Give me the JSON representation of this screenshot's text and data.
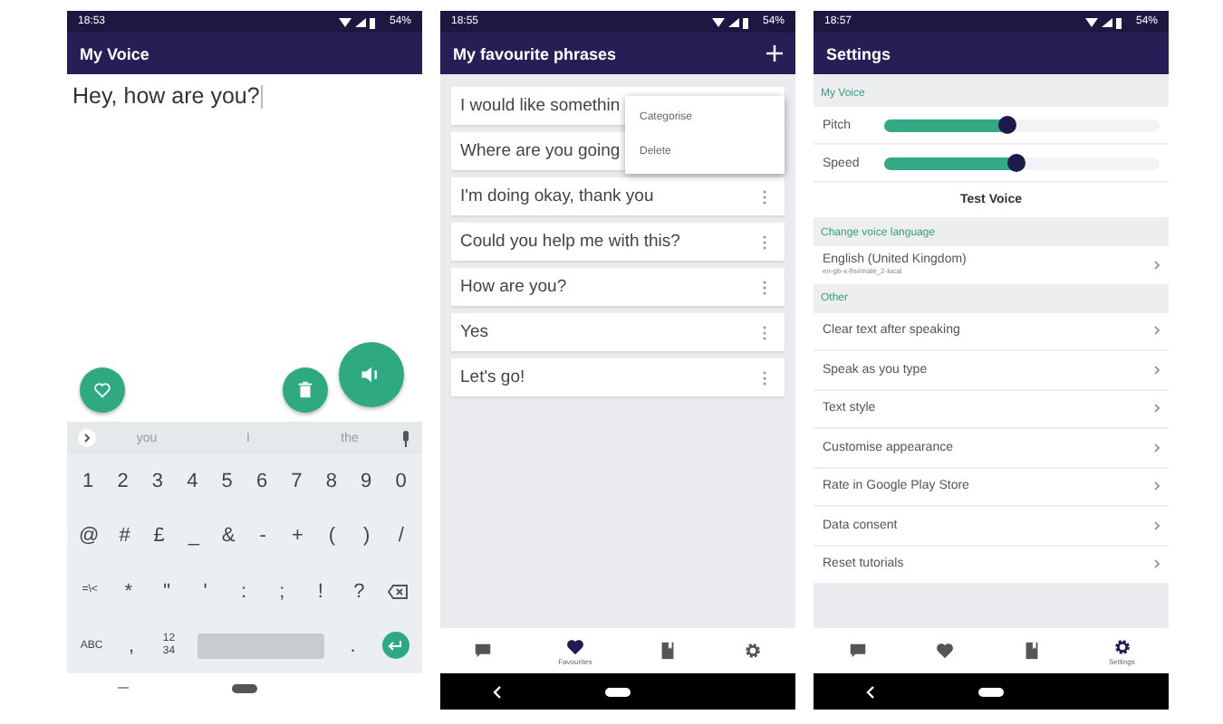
{
  "voice_screen": {
    "status": {
      "time": "18:53",
      "battery": "54%"
    },
    "title": "My Voice",
    "text": "Hey, how are you?",
    "fabs": [
      {
        "kind": "heart"
      },
      {
        "kind": "delete"
      },
      {
        "kind": "speak"
      }
    ],
    "keyboard": {
      "suggestions": [
        "you",
        "I",
        "the"
      ],
      "rows": [
        [
          {
            "kind": "char",
            "label": "1"
          },
          {
            "kind": "char",
            "label": "2"
          },
          {
            "kind": "char",
            "label": "3"
          },
          {
            "kind": "char",
            "label": "4"
          },
          {
            "kind": "char",
            "label": "5"
          },
          {
            "kind": "char",
            "label": "6"
          },
          {
            "kind": "char",
            "label": "7"
          },
          {
            "kind": "char",
            "label": "8"
          },
          {
            "kind": "char",
            "label": "9"
          },
          {
            "kind": "char",
            "label": "0"
          }
        ],
        [
          {
            "kind": "char",
            "label": "@"
          },
          {
            "kind": "char",
            "label": "#"
          },
          {
            "kind": "char",
            "label": "£"
          },
          {
            "kind": "char",
            "label": "_"
          },
          {
            "kind": "char",
            "label": "&"
          },
          {
            "kind": "char",
            "label": "-"
          },
          {
            "kind": "char",
            "label": "+"
          },
          {
            "kind": "char",
            "label": "("
          },
          {
            "kind": "char",
            "label": ")"
          },
          {
            "kind": "char",
            "label": "/"
          }
        ],
        [
          {
            "kind": "small",
            "label": "=\\<"
          },
          {
            "kind": "char",
            "label": "*"
          },
          {
            "kind": "char",
            "label": "\""
          },
          {
            "kind": "char",
            "label": "'"
          },
          {
            "kind": "char",
            "label": ":"
          },
          {
            "kind": "char",
            "label": ";"
          },
          {
            "kind": "char",
            "label": "!"
          },
          {
            "kind": "char",
            "label": "?"
          },
          {
            "kind": "backspace"
          }
        ],
        [
          {
            "kind": "small",
            "label": "ABC"
          },
          {
            "kind": "char",
            "label": ","
          },
          {
            "kind": "small",
            "label": "12\n34"
          },
          {
            "kind": "space"
          },
          {
            "kind": "char",
            "label": "."
          },
          {
            "kind": "enter"
          }
        ]
      ]
    }
  },
  "phrases_screen": {
    "status": {
      "time": "18:55",
      "battery": "54%"
    },
    "title": "My favourite phrases",
    "phrases": [
      "I would like somethin",
      "Where are you going",
      "I'm doing okay, thank you",
      "Could you help me with this?",
      "How are you?",
      "Yes",
      "Let's go!"
    ],
    "menu": [
      "Categorise",
      "Delete"
    ],
    "nav": [
      {
        "kind": "chat",
        "selected": false
      },
      {
        "kind": "heart",
        "selected": true,
        "label": "Favourites"
      },
      {
        "kind": "book",
        "selected": false
      },
      {
        "kind": "gear",
        "selected": false
      }
    ]
  },
  "settings_screen": {
    "status": {
      "time": "18:57",
      "battery": "54%"
    },
    "title": "Settings",
    "rows": [
      {
        "kind": "header",
        "text": "My Voice"
      },
      {
        "kind": "slider",
        "text": "Pitch",
        "level": 0.45
      },
      {
        "kind": "slider",
        "text": "Speed",
        "level": 0.48
      },
      {
        "kind": "button",
        "text": "Test Voice"
      },
      {
        "kind": "header",
        "text": "Change voice language"
      },
      {
        "kind": "link",
        "text": "English (United Kingdom)",
        "subtitle": "en-gb-x-fis#male_2-local"
      },
      {
        "kind": "header",
        "text": "Other"
      },
      {
        "kind": "link",
        "text": "Clear text after speaking"
      },
      {
        "kind": "link",
        "text": "Speak as you type"
      },
      {
        "kind": "link",
        "text": "Text style"
      },
      {
        "kind": "link",
        "text": "Customise appearance"
      },
      {
        "kind": "link",
        "text": "Rate in Google Play Store"
      },
      {
        "kind": "link",
        "text": "Data consent"
      },
      {
        "kind": "link",
        "text": "Reset tutorials"
      }
    ],
    "nav": [
      {
        "kind": "chat",
        "selected": false
      },
      {
        "kind": "heart",
        "selected": false
      },
      {
        "kind": "book",
        "selected": false
      },
      {
        "kind": "gear",
        "selected": true,
        "label": "Settings"
      }
    ]
  }
}
